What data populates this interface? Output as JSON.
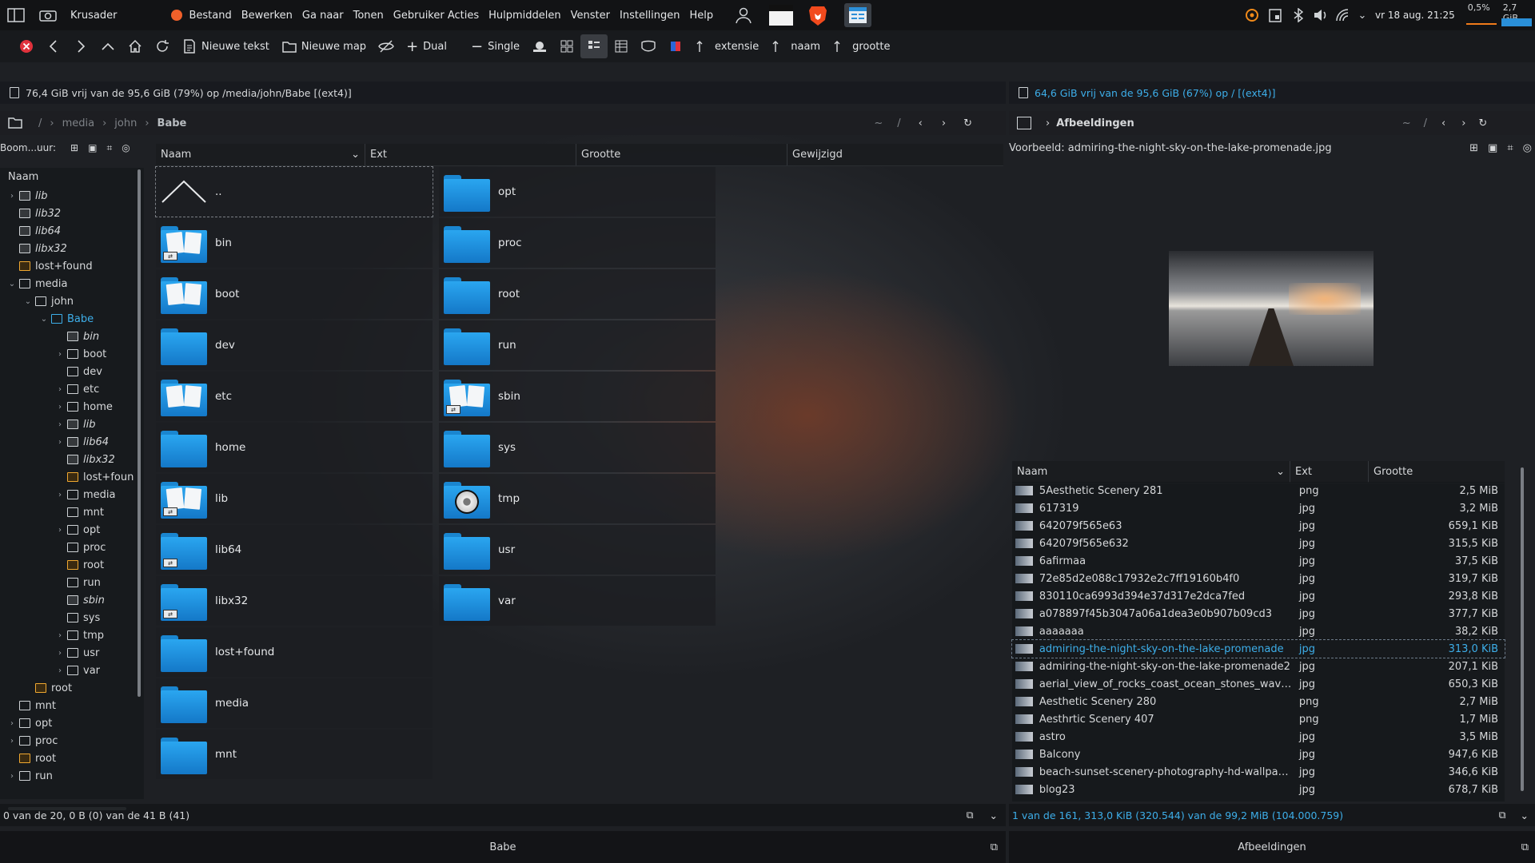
{
  "topbar": {
    "app_name": "Krusader",
    "menu": [
      "Bestand",
      "Bewerken",
      "Ga naar",
      "Tonen",
      "Gebruiker Acties",
      "Hulpmiddelen",
      "Venster",
      "Instellingen",
      "Help"
    ],
    "clock": "vr 18 aug. 21:25",
    "cpu": "0,5%",
    "mem": "2,7 GiB"
  },
  "toolbar": {
    "new_text": "Nieuwe tekst",
    "new_folder": "Nieuwe map",
    "dual": "Dual",
    "single": "Single",
    "sort_ext": "extensie",
    "sort_name": "naam",
    "sort_size": "grootte"
  },
  "left": {
    "free_space": "76,4 GiB vrij van de 95,6 GiB (79%) op /media/john/Babe [(ext4)]",
    "crumbs": [
      "/",
      "media",
      "john",
      "Babe"
    ],
    "crumb_tools": [
      "~",
      "/"
    ],
    "tree_header_label": "Boom...uur:",
    "tree_col": "Naam",
    "tree": [
      {
        "label": "lib",
        "italic": true,
        "exp": "closed",
        "lvl": 0,
        "type": "l"
      },
      {
        "label": "lib32",
        "italic": true,
        "exp": "",
        "lvl": 0,
        "type": "l"
      },
      {
        "label": "lib64",
        "italic": true,
        "exp": "",
        "lvl": 0,
        "type": "l"
      },
      {
        "label": "libx32",
        "italic": true,
        "exp": "",
        "lvl": 0,
        "type": "l"
      },
      {
        "label": "lost+found",
        "italic": false,
        "exp": "",
        "lvl": 0,
        "type": "o"
      },
      {
        "label": "media",
        "italic": false,
        "exp": "open",
        "lvl": 0,
        "type": "n"
      },
      {
        "label": "john",
        "italic": false,
        "exp": "open",
        "lvl": 1,
        "type": "n"
      },
      {
        "label": "Babe",
        "italic": false,
        "exp": "open",
        "lvl": 2,
        "type": "n",
        "sel": true
      },
      {
        "label": "bin",
        "italic": true,
        "exp": "",
        "lvl": 3,
        "type": "l"
      },
      {
        "label": "boot",
        "italic": false,
        "exp": "closed",
        "lvl": 3,
        "type": "n"
      },
      {
        "label": "dev",
        "italic": false,
        "exp": "",
        "lvl": 3,
        "type": "n"
      },
      {
        "label": "etc",
        "italic": false,
        "exp": "closed",
        "lvl": 3,
        "type": "n"
      },
      {
        "label": "home",
        "italic": false,
        "exp": "closed",
        "lvl": 3,
        "type": "n"
      },
      {
        "label": "lib",
        "italic": true,
        "exp": "closed",
        "lvl": 3,
        "type": "l"
      },
      {
        "label": "lib64",
        "italic": true,
        "exp": "closed",
        "lvl": 3,
        "type": "l"
      },
      {
        "label": "libx32",
        "italic": true,
        "exp": "",
        "lvl": 3,
        "type": "l"
      },
      {
        "label": "lost+foun",
        "italic": false,
        "exp": "",
        "lvl": 3,
        "type": "o"
      },
      {
        "label": "media",
        "italic": false,
        "exp": "closed",
        "lvl": 3,
        "type": "n"
      },
      {
        "label": "mnt",
        "italic": false,
        "exp": "",
        "lvl": 3,
        "type": "n"
      },
      {
        "label": "opt",
        "italic": false,
        "exp": "closed",
        "lvl": 3,
        "type": "n"
      },
      {
        "label": "proc",
        "italic": false,
        "exp": "",
        "lvl": 3,
        "type": "n"
      },
      {
        "label": "root",
        "italic": false,
        "exp": "",
        "lvl": 3,
        "type": "o"
      },
      {
        "label": "run",
        "italic": false,
        "exp": "",
        "lvl": 3,
        "type": "n"
      },
      {
        "label": "sbin",
        "italic": true,
        "exp": "",
        "lvl": 3,
        "type": "l"
      },
      {
        "label": "sys",
        "italic": false,
        "exp": "",
        "lvl": 3,
        "type": "n"
      },
      {
        "label": "tmp",
        "italic": false,
        "exp": "closed",
        "lvl": 3,
        "type": "n"
      },
      {
        "label": "usr",
        "italic": false,
        "exp": "closed",
        "lvl": 3,
        "type": "n"
      },
      {
        "label": "var",
        "italic": false,
        "exp": "closed",
        "lvl": 3,
        "type": "n"
      },
      {
        "label": "root",
        "italic": false,
        "exp": "",
        "lvl": 1,
        "type": "o"
      },
      {
        "label": "mnt",
        "italic": false,
        "exp": "",
        "lvl": 0,
        "type": "n"
      },
      {
        "label": "opt",
        "italic": false,
        "exp": "closed",
        "lvl": 0,
        "type": "n"
      },
      {
        "label": "proc",
        "italic": false,
        "exp": "closed",
        "lvl": 0,
        "type": "n"
      },
      {
        "label": "root",
        "italic": false,
        "exp": "",
        "lvl": 0,
        "type": "o"
      },
      {
        "label": "run",
        "italic": false,
        "exp": "closed",
        "lvl": 0,
        "type": "n"
      }
    ],
    "columns": [
      "Naam",
      "Ext",
      "Grootte",
      "Gewijzigd"
    ],
    "files_col1": [
      {
        "name": "..",
        "kind": "up"
      },
      {
        "name": "bin",
        "kind": "linkdoc"
      },
      {
        "name": "boot",
        "kind": "doc"
      },
      {
        "name": "dev",
        "kind": "plain"
      },
      {
        "name": "etc",
        "kind": "doc"
      },
      {
        "name": "home",
        "kind": "plain"
      },
      {
        "name": "lib",
        "kind": "linkdoc"
      },
      {
        "name": "lib64",
        "kind": "link"
      },
      {
        "name": "libx32",
        "kind": "link"
      },
      {
        "name": "lost+found",
        "kind": "plain"
      },
      {
        "name": "media",
        "kind": "plain"
      },
      {
        "name": "mnt",
        "kind": "plain"
      }
    ],
    "files_col2": [
      {
        "name": "opt",
        "kind": "plain"
      },
      {
        "name": "proc",
        "kind": "plain"
      },
      {
        "name": "root",
        "kind": "plain"
      },
      {
        "name": "run",
        "kind": "plain"
      },
      {
        "name": "sbin",
        "kind": "linkdoc"
      },
      {
        "name": "sys",
        "kind": "plain"
      },
      {
        "name": "tmp",
        "kind": "tmp"
      },
      {
        "name": "usr",
        "kind": "plain"
      },
      {
        "name": "var",
        "kind": "plain"
      }
    ],
    "status": "0 van de 20, 0 B (0) van de 41 B (41)",
    "tab": "Babe"
  },
  "right": {
    "free_space": "64,6 GiB vrij van de 95,6 GiB (67%) op / [(ext4)]",
    "crumb": "Afbeeldingen",
    "crumb_tools": [
      "~",
      "/"
    ],
    "preview_label": "Voorbeeld: admiring-the-night-sky-on-the-lake-promenade.jpg",
    "columns": [
      "Naam",
      "Ext",
      "Grootte"
    ],
    "files": [
      {
        "name": "5Aesthetic Scenery 281",
        "ext": "png",
        "size": "2,5 MiB"
      },
      {
        "name": "617319",
        "ext": "jpg",
        "size": "3,2 MiB"
      },
      {
        "name": "642079f565e63",
        "ext": "jpg",
        "size": "659,1 KiB"
      },
      {
        "name": "642079f565e632",
        "ext": "jpg",
        "size": "315,5 KiB"
      },
      {
        "name": "6afirmaa",
        "ext": "jpg",
        "size": "37,5 KiB"
      },
      {
        "name": "72e85d2e088c17932e2c7ff19160b4f0",
        "ext": "jpg",
        "size": "319,7 KiB"
      },
      {
        "name": "830110ca6993d394e37d317e2dca7fed",
        "ext": "jpg",
        "size": "293,8 KiB"
      },
      {
        "name": "a078897f45b3047a06a1dea3e0b907b09cd3",
        "ext": "jpg",
        "size": "377,7 KiB"
      },
      {
        "name": "aaaaaaa",
        "ext": "jpg",
        "size": "38,2 KiB"
      },
      {
        "name": "admiring-the-night-sky-on-the-lake-promenade",
        "ext": "jpg",
        "size": "313,0 KiB",
        "sel": true
      },
      {
        "name": "admiring-the-night-sky-on-the-lake-promenade2",
        "ext": "jpg",
        "size": "207,1 KiB"
      },
      {
        "name": "aerial_view_of_rocks_coast_ocean_stones_waves_...",
        "ext": "jpg",
        "size": "650,3 KiB"
      },
      {
        "name": "Aesthetic Scenery 280",
        "ext": "png",
        "size": "2,7 MiB"
      },
      {
        "name": "Aesthrtic Scenery 407",
        "ext": "png",
        "size": "1,7 MiB"
      },
      {
        "name": "astro",
        "ext": "jpg",
        "size": "3,5 MiB"
      },
      {
        "name": "Balcony",
        "ext": "jpg",
        "size": "947,6 KiB"
      },
      {
        "name": "beach-sunset-scenery-photography-hd-wallpape...",
        "ext": "jpg",
        "size": "346,6 KiB"
      },
      {
        "name": "blog23",
        "ext": "jpg",
        "size": "678,7 KiB"
      }
    ],
    "status": "1 van de 161, 313,0 KiB (320.544) van de 99,2 MiB (104.000.759)",
    "tab": "Afbeeldingen"
  }
}
